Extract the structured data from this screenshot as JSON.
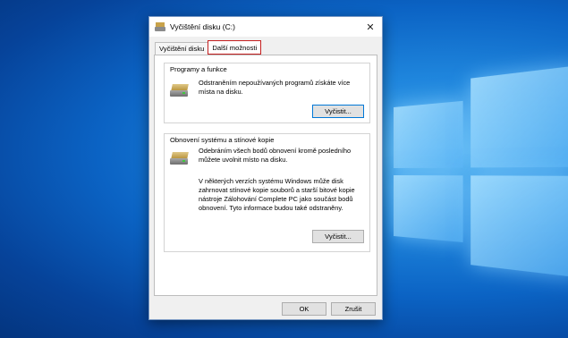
{
  "dialog": {
    "title": "Vyčištění disku  (C:)",
    "close_symbol": "✕"
  },
  "tabs": [
    {
      "label": "Vyčištění disku",
      "active": false
    },
    {
      "label": "Další možnosti",
      "active": true
    }
  ],
  "programs": {
    "title": "Programy a funkce",
    "description": "Odstraněním nepoužívaných programů získáte více místa na disku.",
    "button": "Vyčistit..."
  },
  "restore": {
    "title": "Obnovení systému a stínové kopie",
    "description": "Odebráním všech bodů obnovení kromě posledního můžete uvolnit místo na disku.",
    "note": "V některých verzích systému Windows může disk zahrnovat stínové kopie souborů a starší bitové kopie nástroje Zálohování Complete PC jako součást bodů obnovení. Tyto informace budou také odstraněny.",
    "button": "Vyčistit..."
  },
  "footer": {
    "ok": "OK",
    "cancel": "Zrušit"
  },
  "icons": {
    "title": "disk-cleanup-icon",
    "programs": "drive-icon",
    "restore": "drive-icon"
  },
  "colors": {
    "highlight": "#c41f1f",
    "default_button_border": "#0078d7"
  }
}
